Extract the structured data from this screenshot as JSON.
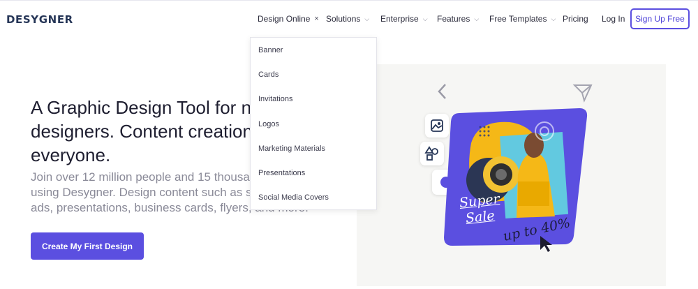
{
  "brand": {
    "logo": "DESYGNER"
  },
  "nav": {
    "design_online": "Design Online",
    "solutions": "Solutions",
    "enterprise": "Enterprise",
    "features": "Features",
    "free_templates": "Free Templates",
    "pricing": "Pricing",
    "login": "Log In",
    "signup": "Sign Up Free",
    "close_glyph": "×",
    "chevron_glyph": "⌄"
  },
  "dropdown": {
    "items": [
      "Banner",
      "Cards",
      "Invitations",
      "Logos",
      "Marketing Materials",
      "Presentations",
      "Social Media Covers"
    ]
  },
  "hero": {
    "headline": "A Graphic Design Tool for non designers. Content creation for everyone.",
    "subtext": "Join over 12 million people and 15 thousand teams using Desygner. Design content such as social posts, ads, presentations, business cards, flyers, and more.",
    "cta": "Create My First Design"
  },
  "illustration": {
    "promo_line1": "Super",
    "promo_line2": "Sale",
    "promo_line3": "up to 40%",
    "icons": [
      "chevron-left-icon",
      "send-icon",
      "image-icon",
      "shapes-icon",
      "circle-dot-icon",
      "cursor-icon"
    ]
  },
  "colors": {
    "accent": "#5b4fe0",
    "logo": "#263657",
    "card": "#5b4fe0",
    "card_yellow": "#f5b817",
    "card_cyan": "#62c9e0"
  }
}
